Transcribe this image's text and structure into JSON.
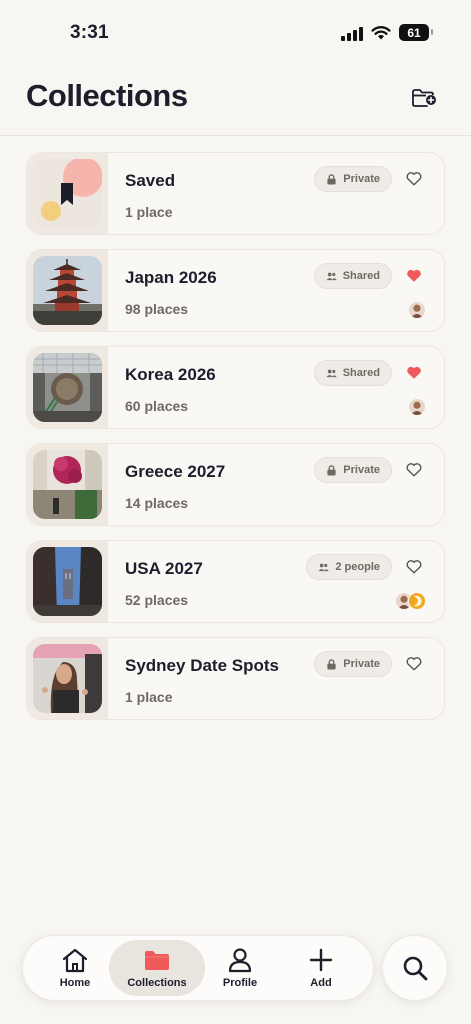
{
  "status_bar": {
    "time": "3:31",
    "battery": "61"
  },
  "header": {
    "title": "Collections"
  },
  "colors": {
    "accent": "#f05a5a",
    "background": "#f8f6f2",
    "text": "#1d1e2c",
    "muted": "#6f6962"
  },
  "collections": [
    {
      "name": "Saved",
      "count": "1 place",
      "visibility": "Private",
      "visibility_icon": "lock-icon",
      "liked": false,
      "avatars": []
    },
    {
      "name": "Japan 2026",
      "count": "98 places",
      "visibility": "Shared",
      "visibility_icon": "people-icon",
      "liked": true,
      "avatars": [
        "avatar-1"
      ]
    },
    {
      "name": "Korea 2026",
      "count": "60 places",
      "visibility": "Shared",
      "visibility_icon": "people-icon",
      "liked": true,
      "avatars": [
        "avatar-1"
      ]
    },
    {
      "name": "Greece 2027",
      "count": "14 places",
      "visibility": "Private",
      "visibility_icon": "lock-icon",
      "liked": false,
      "avatars": []
    },
    {
      "name": "USA 2027",
      "count": "52 places",
      "visibility": "2 people",
      "visibility_icon": "people-icon",
      "liked": false,
      "avatars": [
        "avatar-1",
        "avatar-2"
      ]
    },
    {
      "name": "Sydney Date Spots",
      "count": "1 place",
      "visibility": "Private",
      "visibility_icon": "lock-icon",
      "liked": false,
      "avatars": []
    }
  ],
  "tabbar": {
    "tabs": [
      {
        "label": "Home",
        "icon": "home-icon"
      },
      {
        "label": "Collections",
        "icon": "folder-icon",
        "active": true
      },
      {
        "label": "Profile",
        "icon": "profile-icon"
      },
      {
        "label": "Add",
        "icon": "plus-icon"
      }
    ],
    "search_icon": "search-icon"
  }
}
